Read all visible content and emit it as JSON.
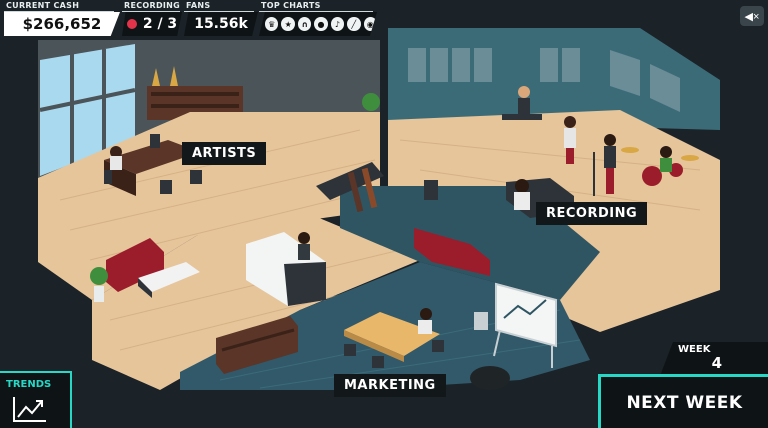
{
  "hud": {
    "cash_label": "CURRENT CASH",
    "cash_value": "$266,652",
    "recording_label": "RECORDING",
    "recording_value": "2 / 3",
    "fans_label": "FANS",
    "fans_value": "15.56k",
    "charts_label": "TOP CHARTS",
    "chart_icons": [
      "crown-icon",
      "star-icon",
      "headphones-icon",
      "person-icon",
      "microphone-icon",
      "tool-icon",
      "disc-icon"
    ]
  },
  "rooms": {
    "artists": "ARTISTS",
    "recording": "RECORDING",
    "marketing": "MARKETING"
  },
  "trends": {
    "label": "TRENDS"
  },
  "week": {
    "label": "WEEK",
    "value": "4"
  },
  "next_week": {
    "label": "NEXT WEEK"
  },
  "colors": {
    "accent": "#27d8c7",
    "recording_dot": "#e3334a",
    "wood_floor": "#e8c9a0",
    "teal_floor": "#2f5563",
    "sofa_red": "#9b1d2c"
  }
}
